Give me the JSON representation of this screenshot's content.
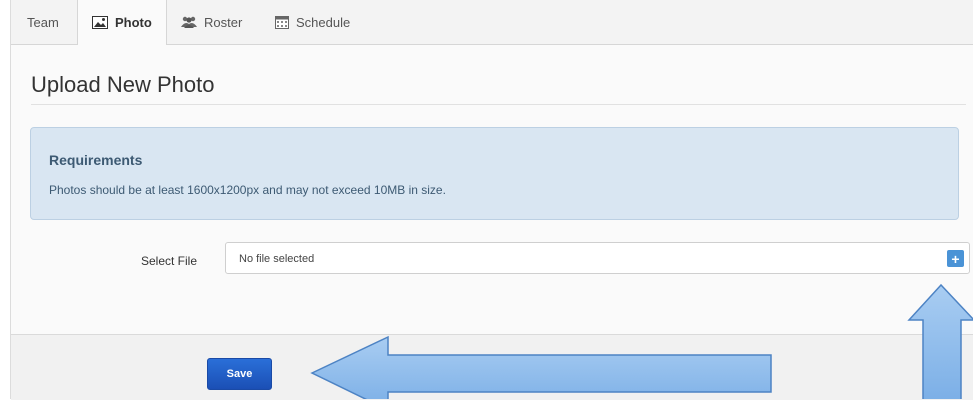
{
  "tabs": [
    {
      "label": "Team",
      "icon": null,
      "active": false
    },
    {
      "label": "Photo",
      "icon": "image-icon",
      "active": true
    },
    {
      "label": "Roster",
      "icon": "users-icon",
      "active": false
    },
    {
      "label": "Schedule",
      "icon": "calendar-icon",
      "active": false
    }
  ],
  "page": {
    "title": "Upload New Photo"
  },
  "requirements": {
    "heading": "Requirements",
    "text": "Photos should be at least 1600x1200px and may not exceed 10MB in size."
  },
  "file_field": {
    "label": "Select File",
    "placeholder": "No file selected",
    "add_button": "+"
  },
  "save_label": "Save",
  "colors": {
    "accent": "#4a93d6",
    "save_button": "#1f5bc4",
    "alert_bg": "#d9e6f2",
    "annotation_arrow": "#8ab8ea"
  }
}
